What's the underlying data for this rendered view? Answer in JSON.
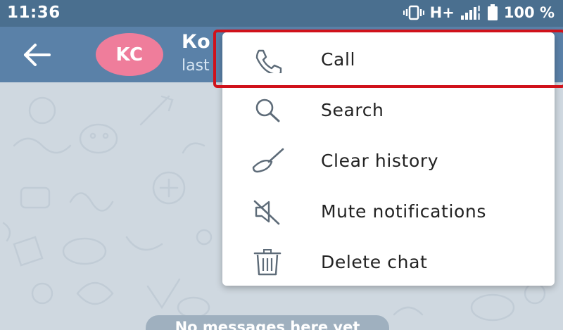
{
  "status_bar": {
    "time": "11:36",
    "network": "H+",
    "battery": "100 %",
    "icons": [
      "vibrate-icon",
      "signal-icon",
      "battery-icon"
    ]
  },
  "header": {
    "avatar_initials": "KC",
    "avatar_color": "#ef7d9b",
    "contact_name": "Ко",
    "contact_status": "last",
    "icons": [
      "back-arrow-icon"
    ]
  },
  "menu": {
    "items": [
      {
        "label": "Call",
        "icon": "phone-icon"
      },
      {
        "label": "Search",
        "icon": "search-icon"
      },
      {
        "label": "Clear history",
        "icon": "broom-icon"
      },
      {
        "label": "Mute notifications",
        "icon": "mute-icon"
      },
      {
        "label": "Delete chat",
        "icon": "trash-icon"
      }
    ]
  },
  "chat": {
    "empty_text": "No messages here yet"
  },
  "colors": {
    "header": "#5a81a8",
    "status_bar": "#4a6f8f",
    "highlight": "#d0121b"
  }
}
